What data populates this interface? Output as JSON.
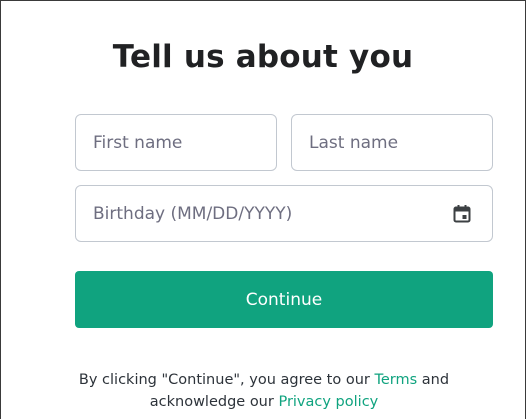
{
  "heading": "Tell us about you",
  "form": {
    "first_name": {
      "placeholder": "First name",
      "value": ""
    },
    "last_name": {
      "placeholder": "Last name",
      "value": ""
    },
    "birthday": {
      "placeholder": "Birthday (MM/DD/YYYY)",
      "value": "",
      "icon": "calendar-icon"
    },
    "continue_label": "Continue"
  },
  "legal": {
    "prefix": "By clicking \"Continue\", you agree to our ",
    "terms_link": "Terms",
    "middle": " and acknowledge our ",
    "privacy_link": "Privacy policy"
  },
  "colors": {
    "accent": "#10a37f",
    "field_border": "#c2c8d0",
    "placeholder": "#6e6e80",
    "heading": "#202123"
  }
}
